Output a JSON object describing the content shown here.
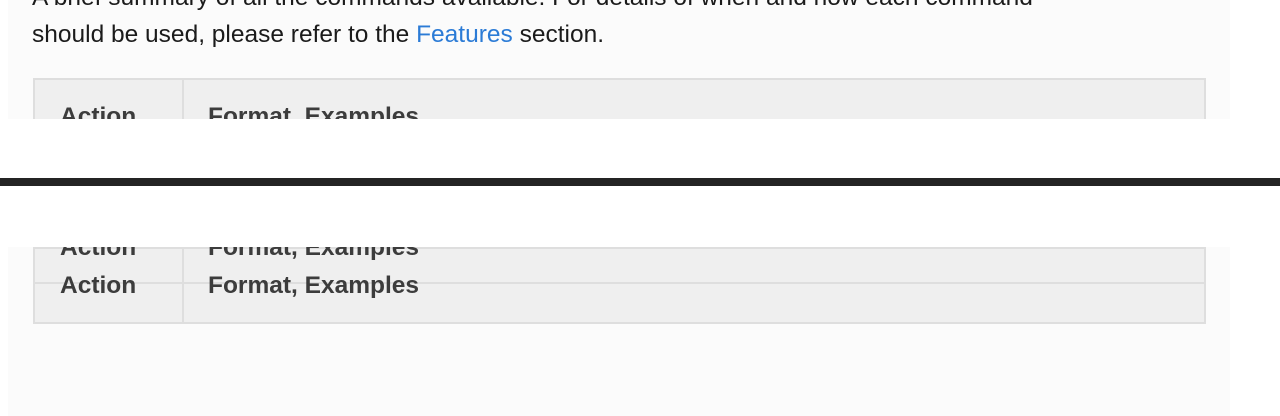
{
  "intro": {
    "line1": "A brief summary of all the commands available. For details of when and how each command",
    "line2_before": "should be used, please refer to the ",
    "line2_link": "Features",
    "line2_after": " section."
  },
  "summary_table": {
    "columns": [
      "Action",
      "Format, Examples"
    ]
  },
  "colors": {
    "link": "#2b7bd6",
    "divider": "#242424",
    "table_header_bg": "#efefef",
    "table_border": "#dedede"
  }
}
